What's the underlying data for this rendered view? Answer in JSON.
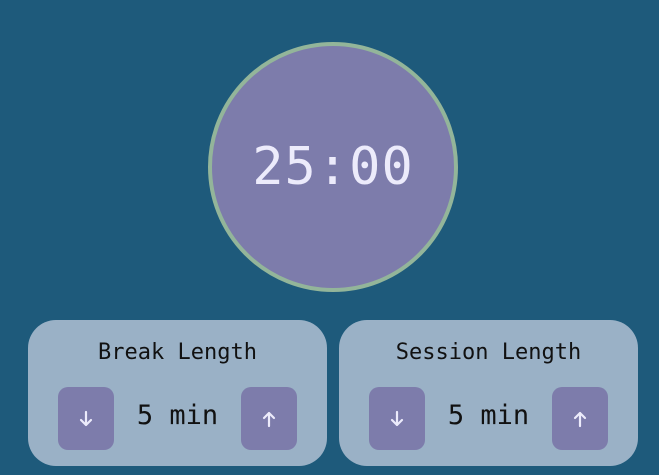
{
  "timer": {
    "display": "25:00"
  },
  "break_panel": {
    "title": "Break Length",
    "value": "5 min",
    "decrement_icon": "arrow-down-icon",
    "increment_icon": "arrow-up-icon"
  },
  "session_panel": {
    "title": "Session Length",
    "value": "5 min",
    "decrement_icon": "arrow-down-icon",
    "increment_icon": "arrow-up-icon"
  },
  "colors": {
    "background": "#1e5a7b",
    "accent": "#7d7cab",
    "timer_ring": "#93b59a",
    "panel": "#9ab1c6",
    "timer_text": "#ecebfb"
  }
}
